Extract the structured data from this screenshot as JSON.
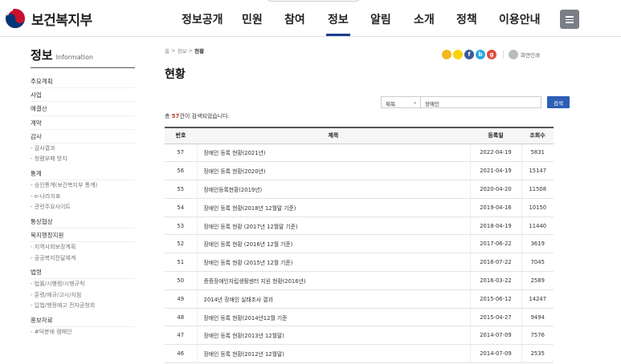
{
  "header": {
    "logo_text": "보건복지부",
    "nav": [
      "정보공개",
      "민원",
      "참여",
      "정보",
      "알림",
      "소개",
      "정책",
      "이용안내"
    ],
    "active_nav": "정보",
    "menu_icon": "hamburger-icon",
    "brand_color": "#1a3e8c"
  },
  "sidebar": {
    "title": "정보",
    "title_en": "Information",
    "items": [
      {
        "label": "주요계획",
        "sub": []
      },
      {
        "label": "사업",
        "sub": []
      },
      {
        "label": "예결산",
        "sub": []
      },
      {
        "label": "계약",
        "sub": []
      },
      {
        "label": "감사",
        "sub": [
          "- 감사결과",
          "- 청렴부패 방지"
        ]
      },
      {
        "label": "통계",
        "sub": [
          "- 승인통계(보건복지부 통계)",
          "- e-나라지표",
          "- 관련주요사이트"
        ]
      },
      {
        "label": "통상협상",
        "sub": []
      },
      {
        "label": "복지행정지원",
        "sub": [
          "- 지역사회보장계획",
          "- 공공복지전달체계"
        ]
      },
      {
        "label": "법령",
        "sub": [
          "- 법률/시행령/시행규칙",
          "- 훈령/예규/고시/지침",
          "- 입법/행정예고 전자공청회"
        ]
      },
      {
        "label": "홍보자료",
        "sub": [
          "- #덕분에 캠페인"
        ]
      }
    ]
  },
  "breadcrumb": {
    "home": "홈",
    "parent": "정보",
    "current": "현황"
  },
  "page_title": "현황",
  "share": {
    "icons": [
      "kakaostory-icon",
      "kakaotalk-icon",
      "facebook-icon",
      "band-icon",
      "googleplus-icon"
    ],
    "print_label": "화면인쇄"
  },
  "search": {
    "field": "제목",
    "query": "장애인",
    "button": "검색"
  },
  "result": {
    "prefix": "총 ",
    "count": "57",
    "suffix": "건이 검색되었습니다."
  },
  "table": {
    "headers": [
      "번호",
      "제목",
      "등록일",
      "조회수"
    ],
    "rows": [
      {
        "no": "57",
        "title": "장애인 등록 현황(2021년)",
        "date": "2022-04-19",
        "views": "5831"
      },
      {
        "no": "56",
        "title": "장애인 등록 현황(2020년)",
        "date": "2021-04-19",
        "views": "15147"
      },
      {
        "no": "55",
        "title": "장애인등록현황(2019년)",
        "date": "2020-04-20",
        "views": "11508"
      },
      {
        "no": "54",
        "title": "장애인 등록 현황(2018년 12월말 기준)",
        "date": "2019-04-16",
        "views": "10150"
      },
      {
        "no": "53",
        "title": "장애인 등록 현황 (2017년 12월말 기준)",
        "date": "2018-04-19",
        "views": "11440"
      },
      {
        "no": "52",
        "title": "장애인 등록 현황 (2016년 12월 기준)",
        "date": "2017-06-22",
        "views": "3619"
      },
      {
        "no": "51",
        "title": "장애인 등록 현황 (2015년 12월 기준)",
        "date": "2016-07-22",
        "views": "7045"
      },
      {
        "no": "50",
        "title": "중증장애인자립생활센터 지원 현황(2016년)",
        "date": "2016-03-22",
        "views": "2589"
      },
      {
        "no": "49",
        "title": "2014년 장애인 실태조사 결과",
        "date": "2015-06-12",
        "views": "14247"
      },
      {
        "no": "48",
        "title": "장애인 등록 현황(2014년12월 기준",
        "date": "2015-04-27",
        "views": "9494"
      },
      {
        "no": "47",
        "title": "장애인 등록 현황(2013년 12월말)",
        "date": "2014-07-09",
        "views": "7576"
      },
      {
        "no": "46",
        "title": "장애인 등록 현황(2012년 12월말)",
        "date": "2014-07-09",
        "views": "2535"
      }
    ]
  }
}
